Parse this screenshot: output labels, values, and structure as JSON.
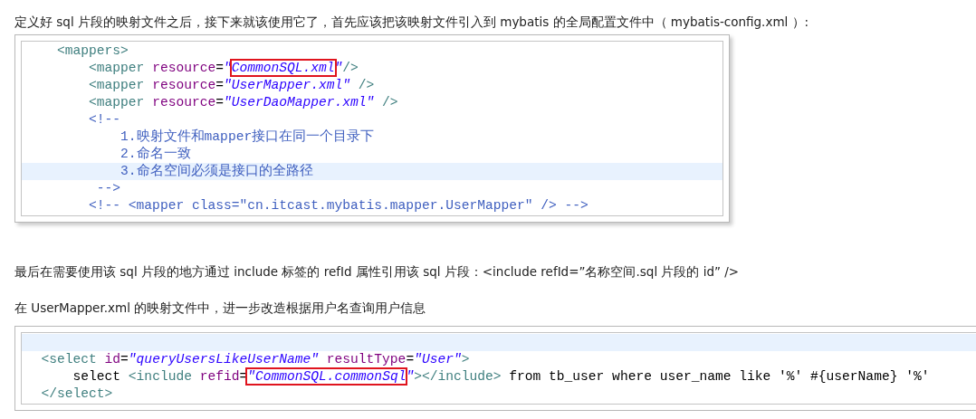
{
  "blocks": [
    {
      "kind": "paragraph",
      "text": "定义好 sql 片段的映射文件之后，接下来就该使用它了，首先应该把该映射文件引入到 mybatis 的全局配置文件中（ mybatis-config.xml ）:"
    },
    {
      "kind": "code",
      "extends_right": false,
      "lines": [
        {
          "highlighted": false,
          "tokens": [
            {
              "kind": "tag",
              "text": "    <mappers>"
            }
          ]
        },
        {
          "highlighted": false,
          "tokens": [
            {
              "kind": "tag",
              "text": "        <mapper "
            },
            {
              "kind": "attr",
              "text": "resource"
            },
            {
              "kind": "text",
              "text": "="
            },
            {
              "kind": "value",
              "text": "\""
            },
            {
              "kind": "value",
              "text": "CommonSQL.xml",
              "boxed": true
            },
            {
              "kind": "value",
              "text": "\""
            },
            {
              "kind": "tag",
              "text": "/>"
            }
          ]
        },
        {
          "highlighted": false,
          "tokens": [
            {
              "kind": "tag",
              "text": "        <mapper "
            },
            {
              "kind": "attr",
              "text": "resource"
            },
            {
              "kind": "text",
              "text": "="
            },
            {
              "kind": "value",
              "text": "\"UserMapper.xml\""
            },
            {
              "kind": "tag",
              "text": " />"
            }
          ]
        },
        {
          "highlighted": false,
          "tokens": [
            {
              "kind": "tag",
              "text": "        <mapper "
            },
            {
              "kind": "attr",
              "text": "resource"
            },
            {
              "kind": "text",
              "text": "="
            },
            {
              "kind": "value",
              "text": "\"UserDaoMapper.xml\""
            },
            {
              "kind": "tag",
              "text": " />"
            }
          ]
        },
        {
          "highlighted": false,
          "tokens": [
            {
              "kind": "comment",
              "text": "        <!--"
            }
          ]
        },
        {
          "highlighted": false,
          "tokens": [
            {
              "kind": "comment",
              "text": "            1.映射文件和mapper接口在同一个目录下"
            }
          ]
        },
        {
          "highlighted": false,
          "tokens": [
            {
              "kind": "comment",
              "text": "            2.命名一致"
            }
          ]
        },
        {
          "highlighted": true,
          "tokens": [
            {
              "kind": "comment",
              "text": "            3.命名空间必须是接口的全路径"
            }
          ]
        },
        {
          "highlighted": false,
          "tokens": [
            {
              "kind": "comment",
              "text": "         -->"
            }
          ]
        },
        {
          "highlighted": false,
          "tokens": [
            {
              "kind": "comment",
              "text": "        <!-- <mapper class=\"cn.itcast.mybatis.mapper.UserMapper\" /> -->"
            }
          ]
        }
      ]
    },
    {
      "kind": "paragraph",
      "text": "最后在需要使用该 sql 片段的地方通过 include 标签的 refId 属性引用该 sql 片段：<include refId=”名称空间.sql 片段的 id” />"
    },
    {
      "kind": "paragraph",
      "text": "在 UserMapper.xml 的映射文件中，进一步改造根据用户名查询用户信息"
    },
    {
      "kind": "code",
      "extends_right": true,
      "lines": [
        {
          "highlighted": true
        },
        {
          "highlighted": false,
          "tokens": [
            {
              "kind": "tag",
              "text": "  <select "
            },
            {
              "kind": "attr",
              "text": "id"
            },
            {
              "kind": "text",
              "text": "="
            },
            {
              "kind": "value",
              "text": "\"queryUsersLikeUserName\""
            },
            {
              "kind": "attr",
              "text": " resultType"
            },
            {
              "kind": "text",
              "text": "="
            },
            {
              "kind": "value",
              "text": "\"User\""
            },
            {
              "kind": "tag",
              "text": ">"
            }
          ]
        },
        {
          "highlighted": false,
          "tokens": [
            {
              "kind": "text",
              "text": "      select "
            },
            {
              "kind": "tag",
              "text": "<include "
            },
            {
              "kind": "attr",
              "text": "refid"
            },
            {
              "kind": "text",
              "text": "="
            },
            {
              "kind": "value",
              "text": "\"CommonSQL.commonSql",
              "boxed": true
            },
            {
              "kind": "value",
              "text": "\""
            },
            {
              "kind": "tag",
              "text": "></include>"
            },
            {
              "kind": "text",
              "text": " from tb_user where user_name like '%' #{userName} '%'"
            }
          ]
        },
        {
          "highlighted": false,
          "tokens": [
            {
              "kind": "tag",
              "text": "  </select>"
            }
          ]
        }
      ]
    }
  ]
}
